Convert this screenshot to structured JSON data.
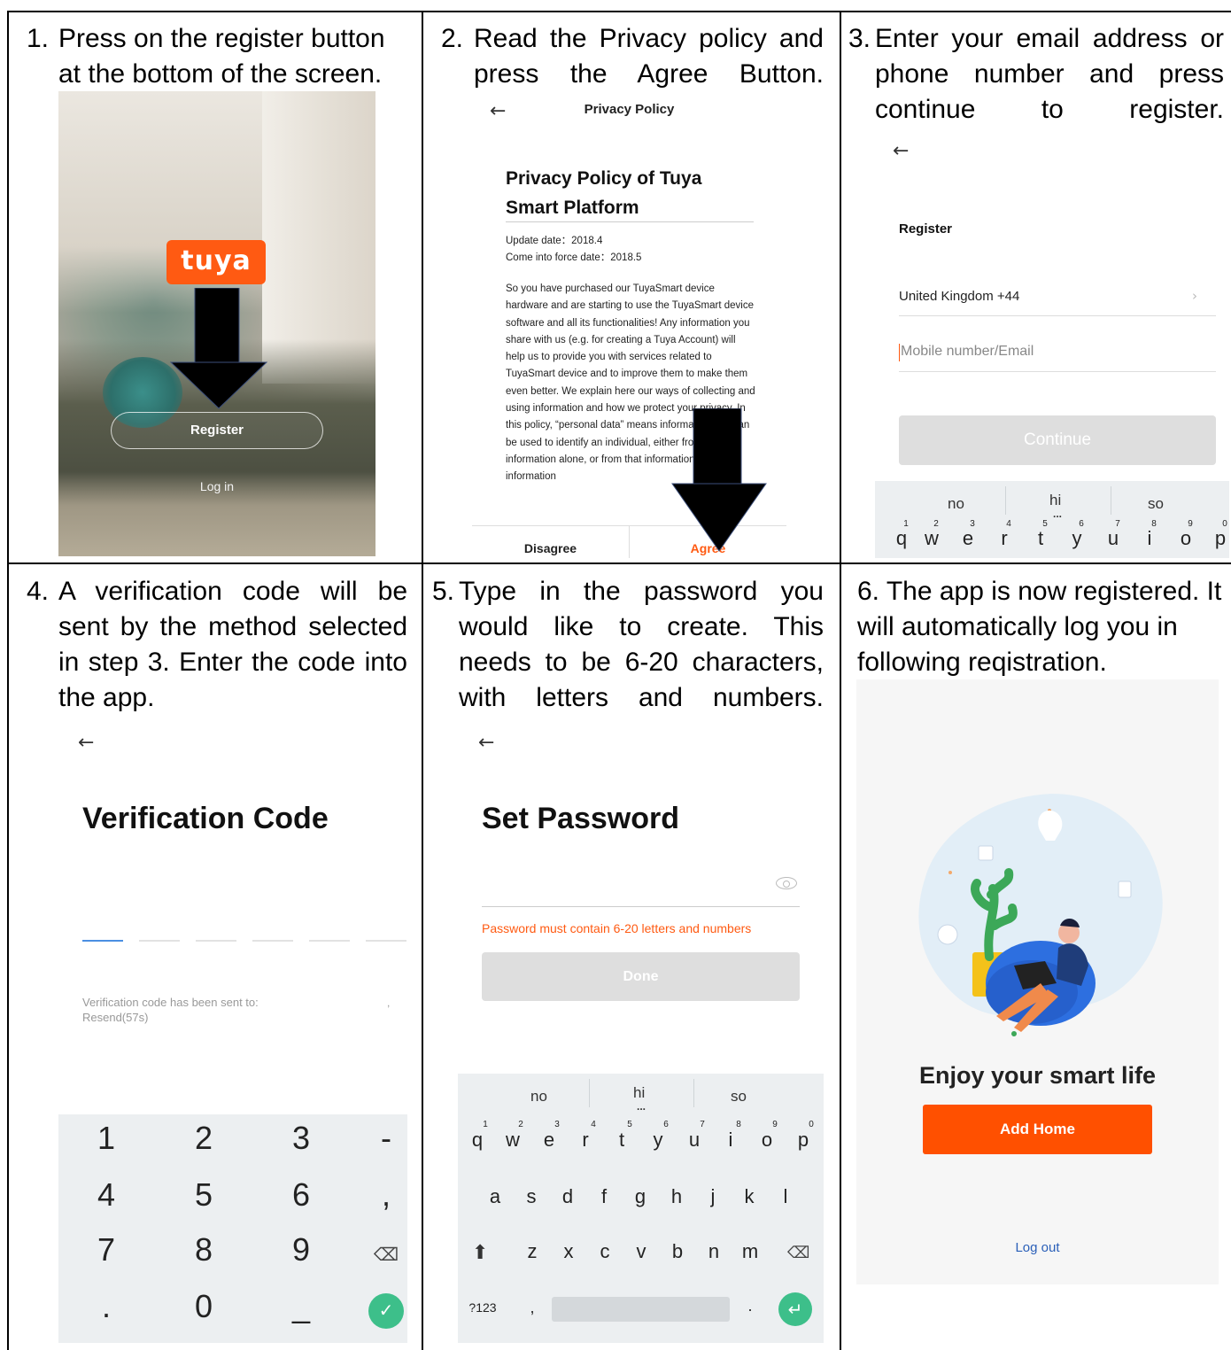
{
  "steps": [
    {
      "num": "1.",
      "text": "Press on the register button at the bottom of the screen."
    },
    {
      "num": "2.",
      "text": "Read the Privacy policy and press the Agree Button."
    },
    {
      "num": "3.",
      "text": "Enter your email address or phone number and press continue to register."
    },
    {
      "num": "4.",
      "text": "A verification code will be sent by the method selected in step 3. Enter the code into the app."
    },
    {
      "num": "5.",
      "text": "Type in the password you would like to create. This needs to be 6-20 characters, with letters and numbers."
    },
    {
      "num": "6.",
      "text": "The app is now registered. It will automatically log you in following reqistration."
    }
  ],
  "screen1": {
    "logo": "tuya",
    "register": "Register",
    "login": "Log in"
  },
  "screen2": {
    "header": "Privacy Policy",
    "title": "Privacy Policy of Tuya Smart Platform",
    "update_date": "Update date：2018.4",
    "force_date": "Come into force date：2018.5",
    "body": "So you have purchased our TuyaSmart device hardware and are starting to use the TuyaSmart device software and all its functionalities! Any information you share with us (e.g. for creating a Tuya Account) will help us to provide you with services related to TuyaSmart device and to improve them to make them even better. We explain here our ways of collecting and using information and how we protect your privacy. In this policy, “personal data” means information that can be used to identify an individual, either from that information alone, or from that information and other information",
    "disagree": "Disagree",
    "agree": "Agree"
  },
  "screen3": {
    "title": "Register",
    "country": "United Kingdom +44",
    "placeholder": "Mobile number/Email",
    "continue": "Continue",
    "suggestions": [
      "no",
      "hi",
      "so"
    ],
    "keys": [
      "q",
      "w",
      "e",
      "r",
      "t",
      "y",
      "u",
      "i",
      "o",
      "p"
    ],
    "key_hints": [
      "1",
      "2",
      "3",
      "4",
      "5",
      "6",
      "7",
      "8",
      "9",
      "0"
    ]
  },
  "screen4": {
    "title": "Verification Code",
    "sent_to": "Verification code has been sent to:",
    "resend": "Resend(57s)",
    "numpad": [
      "1",
      "2",
      "3",
      "-",
      "4",
      "5",
      "6",
      ",",
      "7",
      "8",
      "9",
      "⌫",
      ".",
      "0",
      "_",
      "✓"
    ]
  },
  "screen5": {
    "title": "Set Password",
    "warning": "Password must contain 6-20 letters and numbers",
    "done": "Done",
    "suggestions": [
      "no",
      "hi",
      "so"
    ],
    "row1": [
      "q",
      "w",
      "e",
      "r",
      "t",
      "y",
      "u",
      "i",
      "o",
      "p"
    ],
    "row1_hints": [
      "1",
      "2",
      "3",
      "4",
      "5",
      "6",
      "7",
      "8",
      "9",
      "0"
    ],
    "row2": [
      "a",
      "s",
      "d",
      "f",
      "g",
      "h",
      "j",
      "k",
      "l"
    ],
    "row3": [
      "z",
      "x",
      "c",
      "v",
      "b",
      "n",
      "m"
    ],
    "sym_key": "?123",
    "comma": ",",
    "period": "."
  },
  "screen6": {
    "enjoy": "Enjoy your smart life",
    "add_home": "Add Home",
    "logout": "Log out"
  },
  "colors": {
    "brand": "#ff5a12",
    "link": "#2a5fb8",
    "disabled": "#dedede",
    "accent_green": "#3dbf8a"
  }
}
